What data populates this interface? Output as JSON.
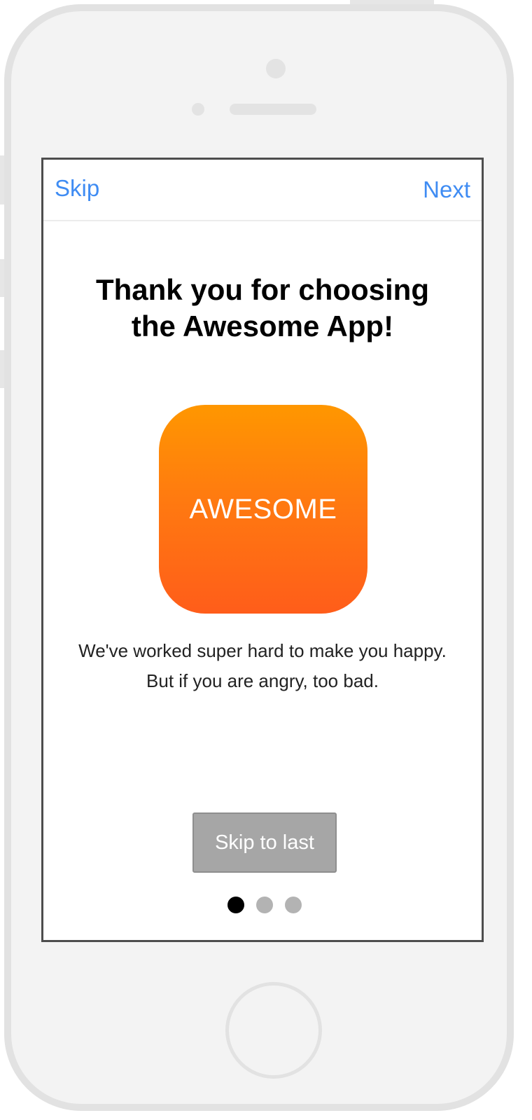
{
  "nav": {
    "left_label": "Skip",
    "right_label": "Next"
  },
  "onboarding": {
    "title_line1": "Thank you for choosing",
    "title_line2": "the Awesome App!",
    "app_icon_label": "AWESOME",
    "description_line1": "We've worked super hard to make you happy.",
    "description_line2": "But if you are angry, too bad.",
    "skip_to_last_label": "Skip to last"
  },
  "page_indicator": {
    "total_pages": 3,
    "current_page": 1,
    "active_color": "#000000",
    "inactive_color": "#b3b3b3"
  },
  "colors": {
    "link": "#3f8cf3",
    "icon_gradient_top": "#ff9700",
    "icon_gradient_bottom": "#ff5d1a",
    "button_bg": "#a6a6a6"
  }
}
